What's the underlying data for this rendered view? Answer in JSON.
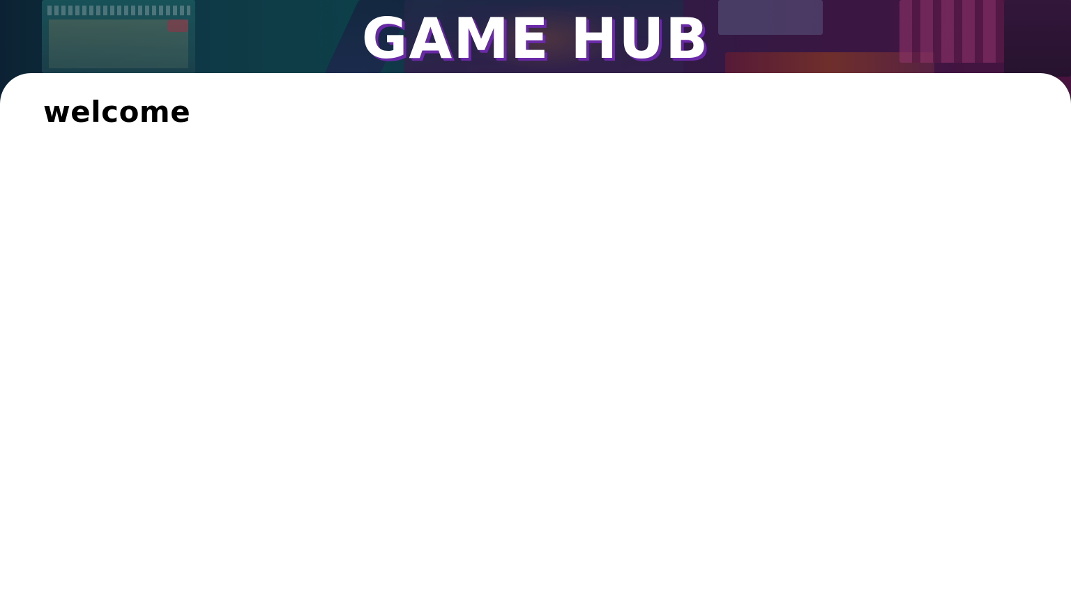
{
  "header": {
    "site_title": "GAME HUB",
    "title_shadow_color": "#6a2aa8",
    "background_image": "arcade-cabinets-photo"
  },
  "main": {
    "heading": "welcome"
  },
  "colors": {
    "card_background": "#ffffff",
    "heading_text": "#000000",
    "title_text": "#ffffff"
  }
}
